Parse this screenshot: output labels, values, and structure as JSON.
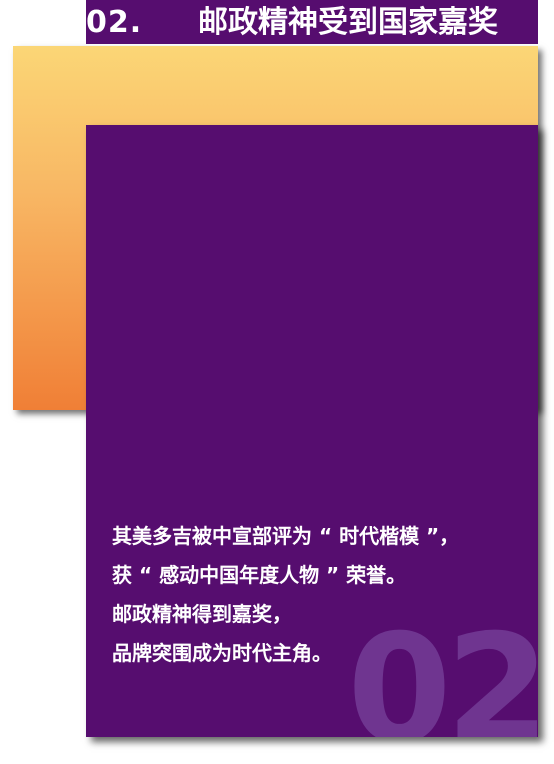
{
  "header": {
    "number": "02.",
    "title": "邮政精神受到国家嘉奖"
  },
  "card": {
    "big_number": "02",
    "lines": [
      "其美多吉被中宣部评为 “ 时代楷模 ”，",
      "获 “ 感动中国年度人物 ” 荣誉。",
      "邮政精神得到嘉奖，",
      "品牌突围成为时代主角。"
    ]
  },
  "colors": {
    "purple": "#560d6f",
    "gradient_top": "#fbd676",
    "gradient_bottom": "#f07f36",
    "watermark": "#6f3590"
  }
}
